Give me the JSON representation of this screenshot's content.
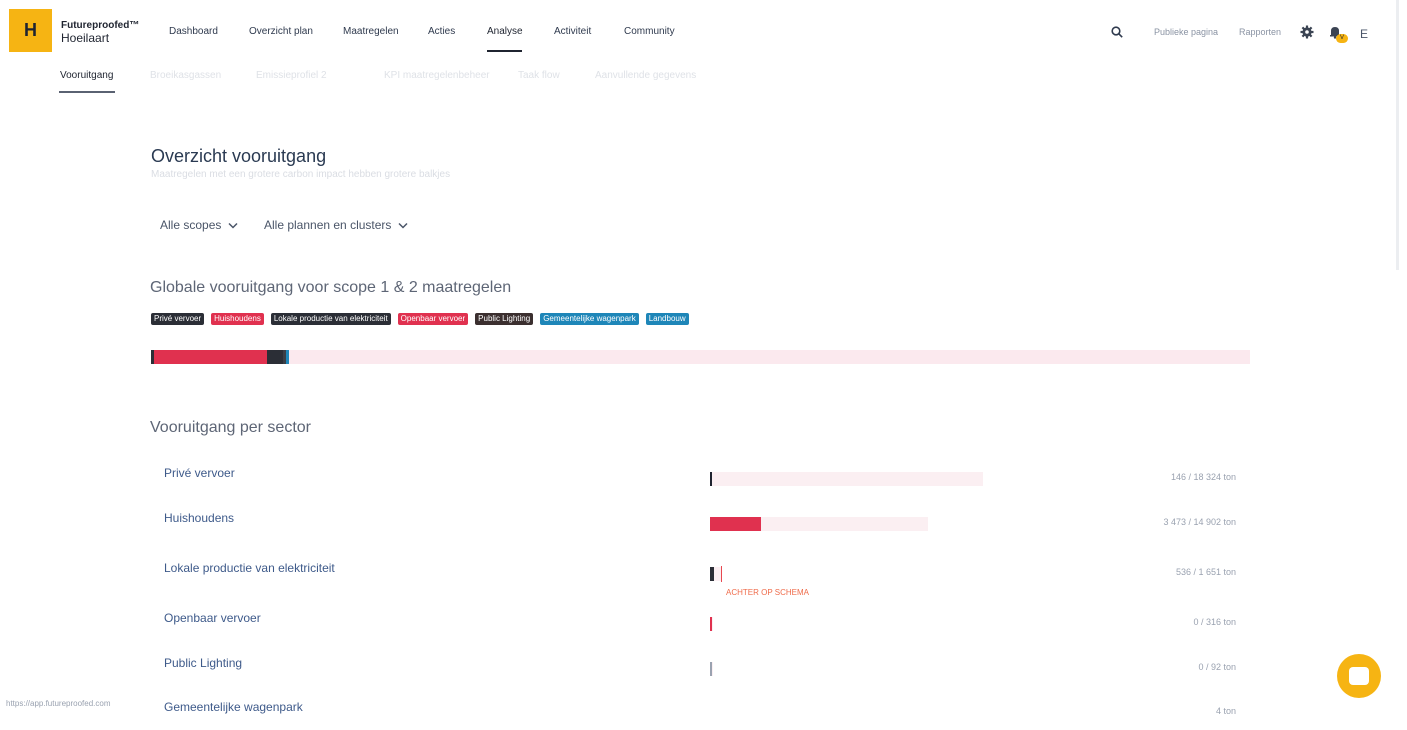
{
  "brand": {
    "logo_letter": "H",
    "line1": "Futureproofed",
    "line1_suffix": "™",
    "line2": "Hoeilaart"
  },
  "nav": {
    "items": [
      {
        "label": "Dashboard"
      },
      {
        "label": "Overzicht plan"
      },
      {
        "label": "Maatregelen"
      },
      {
        "label": "Acties"
      },
      {
        "label": "Analyse"
      },
      {
        "label": "Activiteit"
      },
      {
        "label": "Community"
      }
    ],
    "active": "Analyse"
  },
  "topright": {
    "search_icon": "search-icon",
    "public_page": "Publieke pagina",
    "reports": "Rapporten",
    "gear_icon": "gear-icon",
    "bell_icon": "bell-icon",
    "bell_badge": "V",
    "user_initial": "E"
  },
  "subnav": {
    "items": [
      {
        "label": "Vooruitgang"
      },
      {
        "label": "Broeikasgassen"
      },
      {
        "label": "Emissieprofiel 2"
      },
      {
        "label": "KPI maatregelenbeheer"
      },
      {
        "label": "Taak flow"
      },
      {
        "label": "Aanvullende gegevens"
      }
    ],
    "active": "Vooruitgang"
  },
  "page": {
    "title": "Overzicht vooruitgang",
    "subtitle": "Maatregelen met een grotere carbon impact hebben grotere balkjes"
  },
  "filters": {
    "scopes": "Alle scopes",
    "plans": "Alle plannen en clusters",
    "chevron_icon": "chevron-down-icon"
  },
  "global": {
    "title": "Globale vooruitgang voor scope 1 & 2 maatregelen",
    "legend": [
      {
        "label": "Privé vervoer",
        "color": "#2b2e36"
      },
      {
        "label": "Huishoudens",
        "color": "#e0314f"
      },
      {
        "label": "Lokale productie van elektriciteit",
        "color": "#2b2e36"
      },
      {
        "label": "Openbaar vervoer",
        "color": "#e0314f"
      },
      {
        "label": "Public Lighting",
        "color": "#3b2f2f"
      },
      {
        "label": "Gemeentelijke wagenpark",
        "color": "#1e86b8"
      },
      {
        "label": "Landbouw",
        "color": "#1e86b8"
      }
    ],
    "progress_segments": [
      {
        "name": "Privé vervoer",
        "fraction": 0.003,
        "color": "#2b2e36"
      },
      {
        "name": "Huishoudens",
        "fraction": 0.103,
        "color": "#e0314f"
      },
      {
        "name": "Lokale productie van elektriciteit",
        "fraction": 0.015,
        "color": "#2b2e36"
      },
      {
        "name": "Public Lighting",
        "fraction": 0.003,
        "color": "#3b3e46"
      },
      {
        "name": "Gemeentelijke wagenpark",
        "fraction": 0.003,
        "color": "#1e86b8"
      }
    ],
    "track_color": "#fbe9ee"
  },
  "sectors": {
    "title": "Vooruitgang per sector",
    "rows": [
      {
        "name": "Privé vervoer",
        "value": "146 / 18 324 ton",
        "progress": 0.008,
        "track": 0.5,
        "color": "#1f2430",
        "status": ""
      },
      {
        "name": "Huishoudens",
        "value": "3 473 / 14 902 ton",
        "progress": 0.233,
        "track": 0.4,
        "color": "#e0314f",
        "status": ""
      },
      {
        "name": "Lokale productie van elektriciteit",
        "value": "536 / 1 651 ton",
        "progress": 0.325,
        "track": 0.02,
        "color": "#2b2e36",
        "status": "ACHTER OP SCHEMA"
      },
      {
        "name": "Openbaar vervoer",
        "value": "0 / 316 ton",
        "progress": 0.0,
        "track": 0.004,
        "color": "#e0314f",
        "status": ""
      },
      {
        "name": "Public Lighting",
        "value": "0 / 92 ton",
        "progress": 0.0,
        "track": 0.003,
        "color": "#9aa2b0",
        "status": ""
      },
      {
        "name": "Gemeentelijke wagenpark",
        "value": "4 ton",
        "progress": 0.0,
        "track": 0.0,
        "color": "#1e86b8",
        "status": ""
      }
    ]
  },
  "footer": {
    "status_url": "https://app.futureproofed.com",
    "chat_icon": "chat-icon"
  }
}
